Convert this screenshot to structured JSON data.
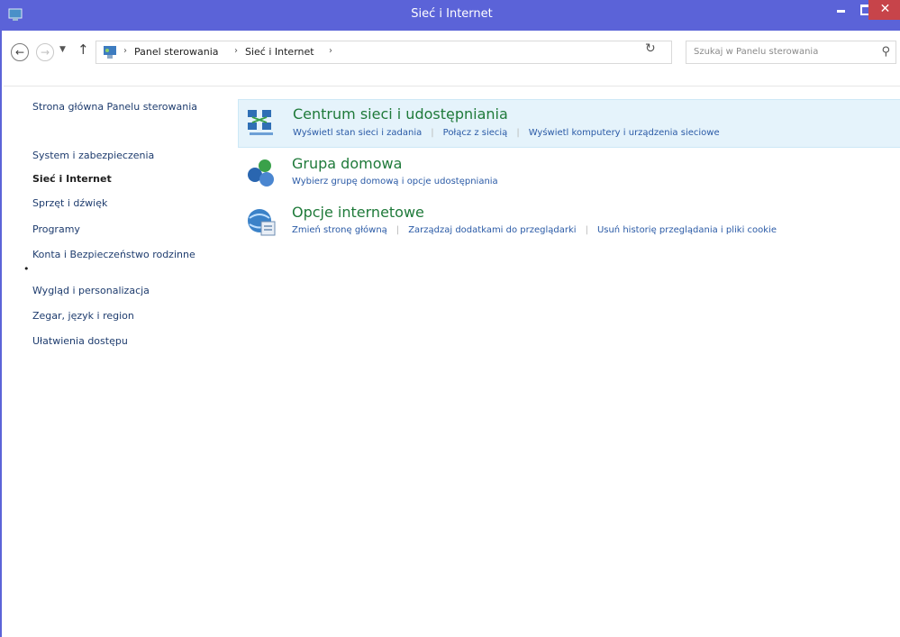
{
  "window": {
    "title": "Sieć i Internet"
  },
  "navigation": {
    "breadcrumb": [
      "Panel sterowania",
      "Sieć i Internet"
    ],
    "search_placeholder": "Szukaj w Panelu sterowania"
  },
  "sidebar": {
    "items": [
      {
        "label": "Strona główna Panelu sterowania",
        "active": false
      },
      {
        "label": "System i zabezpieczenia",
        "active": false
      },
      {
        "label": "Sieć i Internet",
        "active": true
      },
      {
        "label": "Sprzęt i dźwięk",
        "active": false
      },
      {
        "label": "Programy",
        "active": false
      },
      {
        "label": "Konta i Bezpieczeństwo rodzinne",
        "active": false
      },
      {
        "label": "Wygląd i personalizacja",
        "active": false
      },
      {
        "label": "Zegar, język i region",
        "active": false
      },
      {
        "label": "Ułatwienia dostępu",
        "active": false
      }
    ]
  },
  "sections": [
    {
      "title": "Centrum sieci i udostępniania",
      "icon": "network-center-icon",
      "highlighted": true,
      "links": [
        "Wyświetl stan sieci i zadania",
        "Połącz z siecią",
        "Wyświetl komputery i urządzenia sieciowe"
      ]
    },
    {
      "title": "Grupa domowa",
      "icon": "homegroup-icon",
      "highlighted": false,
      "links": [
        "Wybierz grupę domową i opcje udostępniania"
      ]
    },
    {
      "title": "Opcje internetowe",
      "icon": "internet-options-icon",
      "highlighted": false,
      "links": [
        "Zmień stronę główną",
        "Zarządzaj dodatkami do przeglądarki",
        "Usuń historię przeglądania i pliki cookie"
      ]
    }
  ],
  "colors": {
    "titlebar": "#5b63d8",
    "close_button": "#c7444a",
    "section_title": "#1f7a3a",
    "link": "#2a5aa6",
    "highlight": "#e5f3fb"
  }
}
